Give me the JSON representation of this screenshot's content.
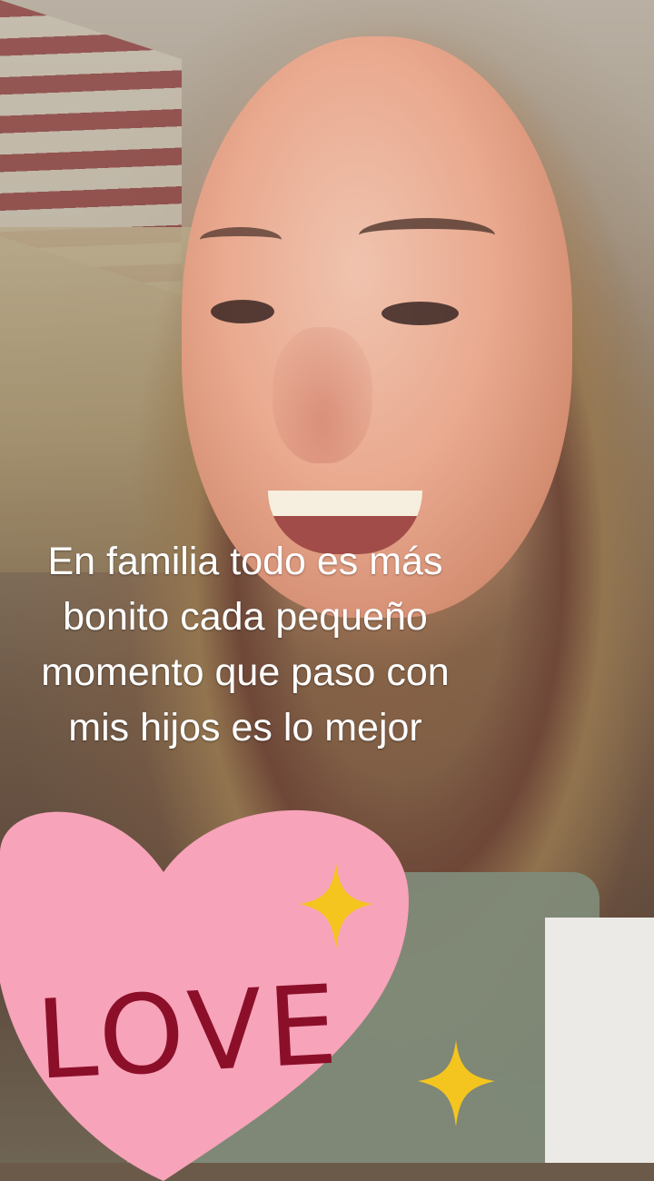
{
  "caption": {
    "lines": [
      "En familia todo es más",
      "bonito cada pequeño",
      "momento que paso con",
      "mis hijos es lo mejor"
    ]
  },
  "sticker": {
    "text": "LOVE",
    "heart_color": "#f7a3b9",
    "text_color": "#8c0f2a",
    "sparkle_color": "#f5c51f",
    "icon": "heart-icon"
  }
}
